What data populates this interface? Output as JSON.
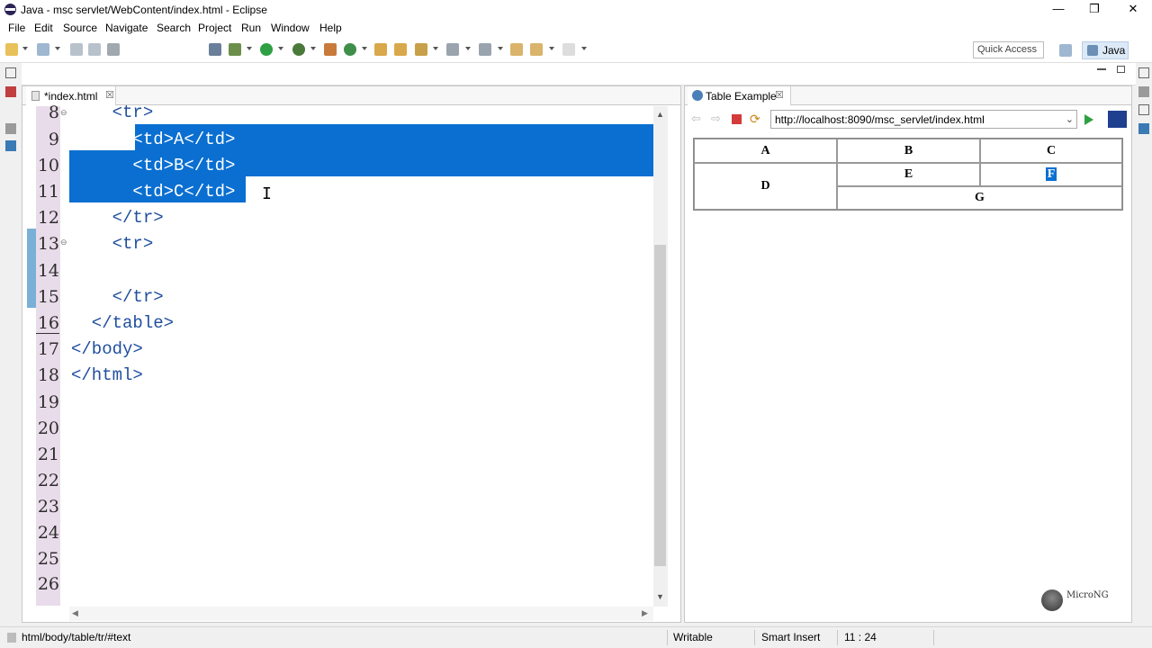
{
  "window": {
    "title": "Java - msc servlet/WebContent/index.html - Eclipse",
    "minimize_glyph": "—",
    "restore_glyph": "❐",
    "close_glyph": "✕"
  },
  "menu": [
    "File",
    "Edit",
    "Source",
    "Navigate",
    "Search",
    "Project",
    "Run",
    "Window",
    "Help"
  ],
  "toolbar": {
    "quick_access_placeholder": "Quick Access",
    "perspective_label": "Java"
  },
  "editor": {
    "tab_label": "*index.html",
    "tab_close": "☒",
    "lines": [
      {
        "num": "8",
        "code": "    <tr>"
      },
      {
        "num": "9",
        "code": "      <td>A</td>"
      },
      {
        "num": "10",
        "code": "      <td>B</td>"
      },
      {
        "num": "11",
        "code": "      <td>C</td>"
      },
      {
        "num": "12",
        "code": "    </tr>"
      },
      {
        "num": "13",
        "code": "    <tr>"
      },
      {
        "num": "14",
        "code": ""
      },
      {
        "num": "15",
        "code": "    </tr>"
      },
      {
        "num": "16",
        "code": "  </table>"
      },
      {
        "num": "17",
        "code": "</body>"
      },
      {
        "num": "18",
        "code": "</html>"
      },
      {
        "num": "19",
        "code": ""
      },
      {
        "num": "20",
        "code": ""
      },
      {
        "num": "21",
        "code": ""
      },
      {
        "num": "22",
        "code": ""
      },
      {
        "num": "23",
        "code": ""
      },
      {
        "num": "24",
        "code": ""
      },
      {
        "num": "25",
        "code": ""
      },
      {
        "num": "26",
        "code": ""
      }
    ],
    "cursor_glyph": "I"
  },
  "browser": {
    "tab_label": "Table Example",
    "tab_close": "☒",
    "url": "http://localhost:8090/msc_servlet/index.html",
    "url_dropdown": "⌄",
    "table": {
      "a": "A",
      "b": "B",
      "c": "C",
      "d": "D",
      "e": "E",
      "f": "F",
      "g": "G"
    },
    "logo_text": "MicroNG"
  },
  "status": {
    "path": "html/body/table/tr/#text",
    "writable": "Writable",
    "insert_mode": "Smart Insert",
    "position": "11 : 24"
  }
}
